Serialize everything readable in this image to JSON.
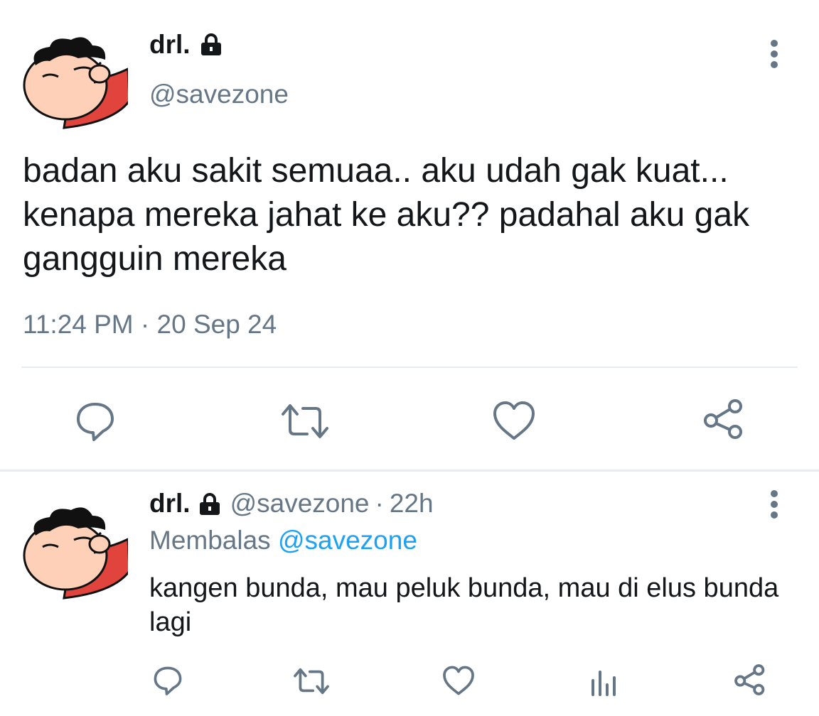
{
  "main_tweet": {
    "display_name": "drl.",
    "handle": "@savezone",
    "text": "badan aku sakit semuaa.. aku udah gak kuat... kenapa mereka jahat ke aku?? padahal aku gak gangguin mereka",
    "timestamp": "11:24 PM · 20 Sep 24",
    "actions": [
      "reply-icon",
      "retweet-icon",
      "like-icon",
      "share-icon"
    ]
  },
  "reply_tweet": {
    "display_name": "drl.",
    "handle": "@savezone",
    "separator": "·",
    "time": "22h",
    "replying_label": "Membalas",
    "replying_to": "@savezone",
    "text": "kangen bunda, mau peluk bunda, mau di elus bunda lagi",
    "actions": [
      "reply-icon",
      "retweet-icon",
      "like-icon",
      "analytics-icon",
      "share-icon"
    ]
  },
  "colors": {
    "text": "#14171a",
    "secondary": "#657786",
    "link": "#1da1f2",
    "icon": "#657786",
    "divider": "#e6ecf0"
  }
}
